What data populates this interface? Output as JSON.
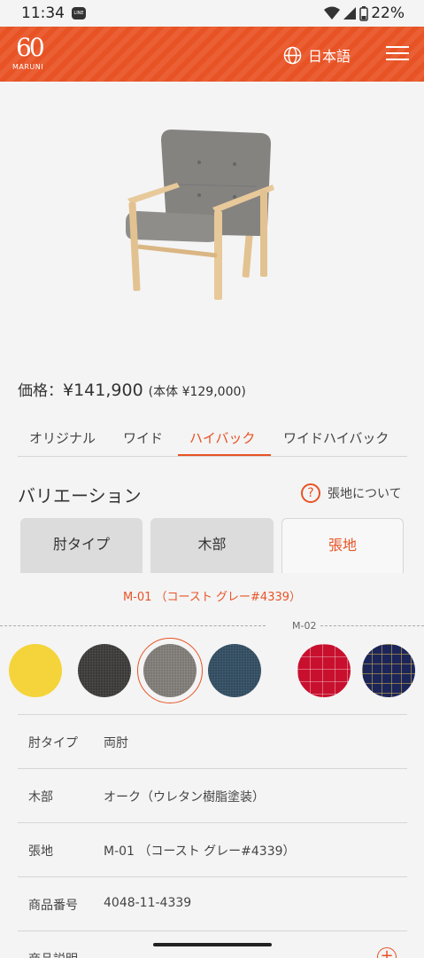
{
  "status_bar": {
    "time": "11:34",
    "app_badge": "LINE",
    "battery": "22%"
  },
  "header": {
    "logo_number": "60",
    "logo_text": "MARUNI",
    "language": "日本語"
  },
  "product": {
    "price_label": "価格：",
    "price": "¥141,900",
    "body_price": "(本体 ¥129,000)"
  },
  "tabs": [
    {
      "label": "オリジナル"
    },
    {
      "label": "ワイド"
    },
    {
      "label": "ハイバック"
    },
    {
      "label": "ワイドハイバック"
    }
  ],
  "variation": {
    "title": "バリエーション",
    "fabric_link": "張地について",
    "tabs": [
      {
        "label": "肘タイプ"
      },
      {
        "label": "木部"
      },
      {
        "label": "張地"
      }
    ],
    "selected_fabric": "M-01 （コースト グレー#4339）",
    "group_label": "M-02"
  },
  "swatches": [
    {
      "color": "#f4d43a"
    },
    {
      "color": "#3a3836"
    },
    {
      "color": "#7b7772",
      "selected": true
    },
    {
      "color": "#2f4a5e"
    },
    {
      "color": "#c8102e"
    },
    {
      "color": "#1c2559"
    }
  ],
  "specs": [
    {
      "key": "肘タイプ",
      "value": "両肘"
    },
    {
      "key": "木部",
      "value": "オーク（ウレタン樹脂塗装）"
    },
    {
      "key": "張地",
      "value": "M-01 （コースト グレー#4339）"
    },
    {
      "key": "商品番号",
      "value": "4048-11-4339"
    },
    {
      "key": "商品説明",
      "value": ""
    }
  ],
  "colors": {
    "accent": "#e85325",
    "background": "#f4f4f4"
  }
}
